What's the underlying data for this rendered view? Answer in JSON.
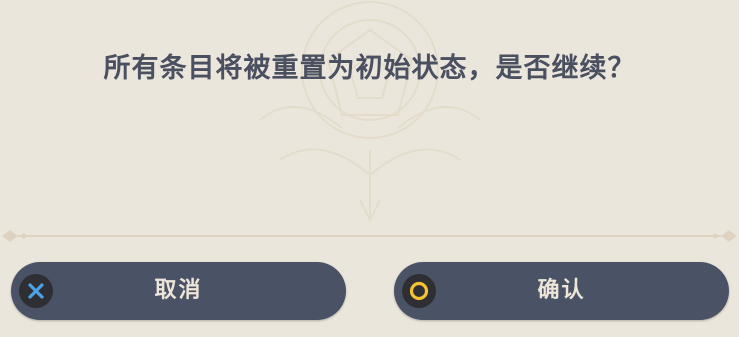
{
  "dialog": {
    "message": "所有条目将被重置为初始状态，是否继续？"
  },
  "buttons": {
    "cancel": {
      "label": "取消",
      "icon": "cross-icon",
      "icon_color": "#4aa3e8"
    },
    "confirm": {
      "label": "确认",
      "icon": "circle-icon",
      "icon_color": "#f4c430"
    }
  },
  "colors": {
    "background": "#ebe6dc",
    "text": "#4b5061",
    "button": "#4a5366",
    "button_text": "#ece5d8"
  }
}
